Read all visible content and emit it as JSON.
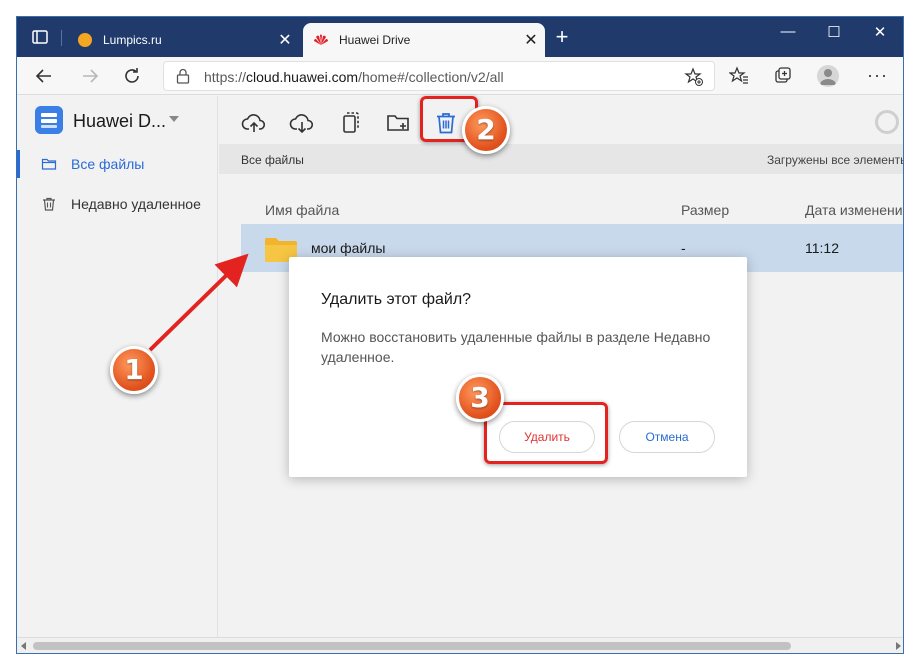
{
  "browser": {
    "tabs": [
      {
        "title": "Lumpics.ru",
        "close": "✕",
        "active": false,
        "favicon_color": "#f5a623"
      },
      {
        "title": "Huawei Drive",
        "close": "✕",
        "active": true,
        "favicon_color": "#e0222c"
      }
    ],
    "new_tab": "+",
    "window_controls": {
      "minimize": "—",
      "maximize": "☐",
      "close": "✕"
    },
    "address": {
      "url_prefix": "https://",
      "url_host": "cloud.huawei.com",
      "url_path": "/home#/collection/v2/all"
    },
    "more": "···",
    "theme_color": "#1f3a6b"
  },
  "app": {
    "name": "Huawei D...",
    "sidebar": [
      {
        "label": "Все файлы",
        "icon": "folder-icon",
        "active": true
      },
      {
        "label": "Недавно удаленное",
        "icon": "trash-icon",
        "active": false
      }
    ],
    "toolbar": [
      "upload-icon",
      "download-icon",
      "copy-icon",
      "new-folder-icon",
      "delete-icon"
    ],
    "breadcrumb": "Все файлы",
    "uploaded_status": "Загружены все элементы",
    "columns": {
      "name": "Имя файла",
      "size": "Размер",
      "date": "Дата изменения"
    },
    "rows": [
      {
        "name": "мои файлы",
        "size": "-",
        "date": "11:12"
      }
    ],
    "accent": "#2a6bd6"
  },
  "dialog": {
    "title": "Удалить этот файл?",
    "text": "Можно восстановить удаленные файлы в разделе Недавно удаленное.",
    "delete_label": "Удалить",
    "cancel_label": "Отмена",
    "delete_color": "#e0332f"
  },
  "annotations": {
    "markers": [
      "1",
      "2",
      "3"
    ],
    "highlight_color": "#e3231f"
  }
}
